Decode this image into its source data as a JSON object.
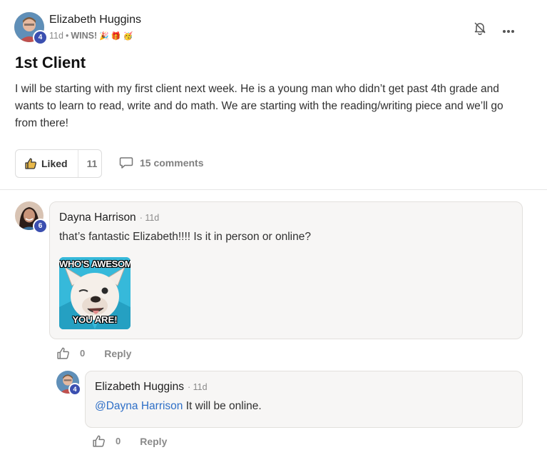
{
  "post": {
    "author": "Elizabeth Huggins",
    "author_level": "4",
    "time": "11d",
    "sep": "•",
    "category": "WINS!",
    "emojis": [
      "🎉",
      "🎁",
      "🥳"
    ],
    "title": "1st Client",
    "body": "I will be starting with my first client next week. He is a young man who didn’t get past 4th grade and wants to learn to read, write and do math. We are starting with the reading/writing piece and we’ll go from there!",
    "liked_label": "Liked",
    "like_count": "11",
    "comments_label": "15 comments"
  },
  "comments": [
    {
      "author": "Dayna Harrison",
      "level": "6",
      "time": "· 11d",
      "text": "that’s fantastic Elizabeth!!!! Is it in person or online?",
      "meme_top": "WHO'S AWESOME",
      "meme_bottom": "YOU ARE!",
      "like_count": "0",
      "reply_label": "Reply"
    },
    {
      "author": "Elizabeth Huggins",
      "level": "4",
      "time": "· 11d",
      "mention": "@Dayna Harrison",
      "text": " It will be online.",
      "like_count": "0",
      "reply_label": "Reply"
    }
  ],
  "colors": {
    "badge": "#3b4fb0",
    "mention": "#2e6fc7",
    "bubble": "#f7f6f5"
  },
  "icons": [
    "bell-off-icon",
    "more-icon",
    "thumbs-up-icon",
    "comment-icon"
  ]
}
